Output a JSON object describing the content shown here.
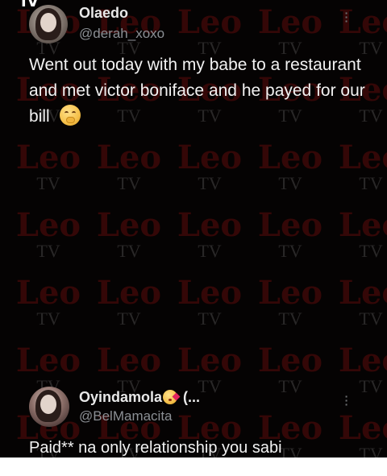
{
  "watermark": {
    "leo": "Leo",
    "tv": "TV"
  },
  "top_fragment": "IV",
  "tweets": [
    {
      "name": "Olaedo",
      "handle": "@derah_xoxo",
      "text": "Went out today with my babe to a restaurant and met victor boniface and he payed for our bill",
      "emoji": "face-with-hand-over-mouth-icon"
    },
    {
      "name": "Oyindamola",
      "name_suffix": "(...",
      "name_emoji": "face-blowing-a-kiss-icon",
      "handle": "@BelMamacita",
      "text": "Paid** na only relationship you sabi"
    }
  ],
  "colors": {
    "background": "#050303",
    "text": "#f2f2f2",
    "handle": "#8b8f94",
    "watermark_red": "#780e0e"
  }
}
